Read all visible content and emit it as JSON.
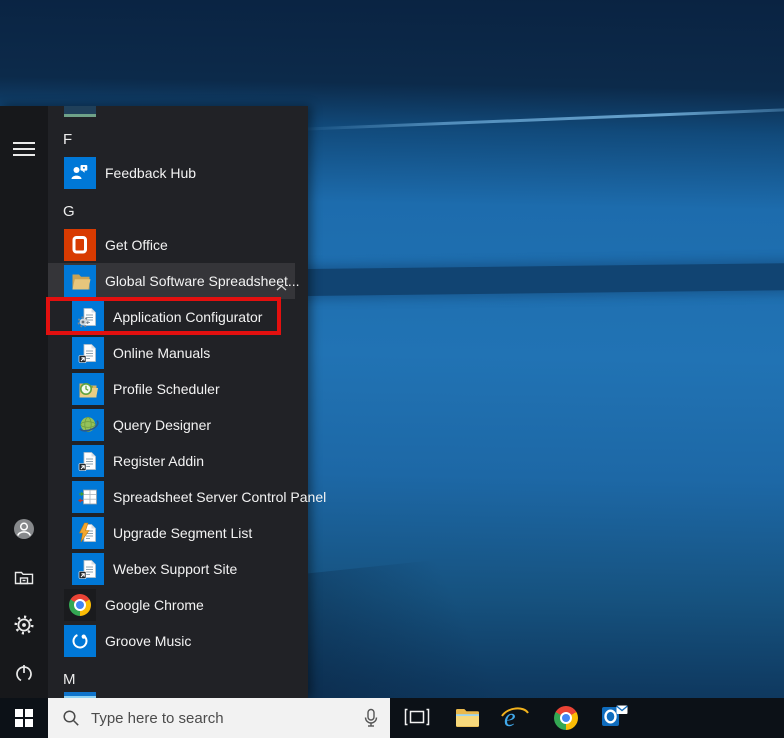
{
  "start_menu": {
    "items": [
      {
        "type": "letter",
        "label": "F"
      },
      {
        "type": "app",
        "label": "Feedback Hub",
        "icon": "feedback-hub-icon"
      },
      {
        "type": "letter",
        "label": "G"
      },
      {
        "type": "app",
        "label": "Get Office",
        "icon": "get-office-icon"
      },
      {
        "type": "folder",
        "label": "Global Software Spreadsheet...",
        "icon": "folder-icon",
        "state": "expanded",
        "highlighted": true,
        "chevron": "up"
      },
      {
        "type": "subapp",
        "label": "Application Configurator",
        "icon": "document-gear-icon",
        "red_box": true
      },
      {
        "type": "subapp",
        "label": "Online Manuals",
        "icon": "document-shortcut-icon"
      },
      {
        "type": "subapp",
        "label": "Profile Scheduler",
        "icon": "folder-clock-icon"
      },
      {
        "type": "subapp",
        "label": "Query Designer",
        "icon": "globe-icon"
      },
      {
        "type": "subapp",
        "label": "Register Addin",
        "icon": "document-shortcut-icon"
      },
      {
        "type": "subapp",
        "label": "Spreadsheet Server Control Panel",
        "icon": "spreadsheet-grid-icon"
      },
      {
        "type": "subapp",
        "label": "Upgrade Segment List",
        "icon": "document-bolt-icon"
      },
      {
        "type": "subapp",
        "label": "Webex Support Site",
        "icon": "document-shortcut-icon"
      },
      {
        "type": "app",
        "label": "Google Chrome",
        "icon": "chrome-icon"
      },
      {
        "type": "app",
        "label": "Groove Music",
        "icon": "groove-icon"
      },
      {
        "type": "letter",
        "label": "M"
      }
    ],
    "rail_icons": [
      "hamburger-menu-icon",
      "user-avatar-icon",
      "documents-icon",
      "settings-gear-icon",
      "power-icon"
    ]
  },
  "annotation": {
    "red_box_target": "Application Configurator",
    "red_box_color": "#e3100f"
  },
  "taskbar": {
    "search": {
      "placeholder": "Type here to search"
    },
    "button_icons": [
      "windows-start-icon",
      "task-view-icon",
      "file-explorer-icon",
      "internet-explorer-icon",
      "chrome-icon",
      "outlook-icon"
    ]
  },
  "colors": {
    "tile_accent": "#0078d7",
    "get_office_tile": "#d83b01",
    "menu_panel": "#212226",
    "taskbar": "#0c1117",
    "wallpaper_mid": "#2173b4"
  }
}
